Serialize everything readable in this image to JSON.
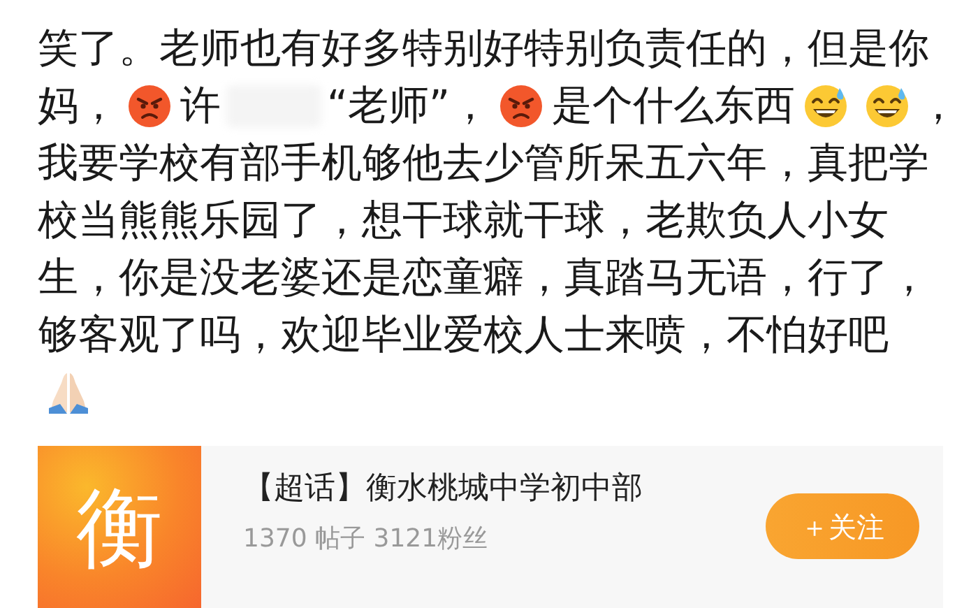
{
  "post": {
    "lines": [
      [
        {
          "kind": "text",
          "text": "笑了。老师也有好多特别好特别负责任的，但是你"
        }
      ],
      [
        {
          "kind": "text",
          "text": "妈，"
        },
        {
          "kind": "angry"
        },
        {
          "kind": "text",
          "text": "许"
        },
        {
          "kind": "blur"
        },
        {
          "kind": "text",
          "text": "“老师”，"
        },
        {
          "kind": "angry"
        },
        {
          "kind": "text",
          "text": "是个什么东西"
        },
        {
          "kind": "sweat"
        },
        {
          "kind": "sweat"
        },
        {
          "kind": "text",
          "text": "，"
        }
      ],
      [
        {
          "kind": "text",
          "text": "我要学校有部手机够他去少管所呆五六年，真把学"
        }
      ],
      [
        {
          "kind": "text",
          "text": "校当熊熊乐园了，想干球就干球，老欺负人小女"
        }
      ],
      [
        {
          "kind": "text",
          "text": "生，你是没老婆还是恋童癖，真踏马无语，行了，"
        }
      ],
      [
        {
          "kind": "text",
          "text": "够客观了吗，欢迎毕业爱校人士来喷，不怕好吧"
        }
      ],
      [
        {
          "kind": "pray"
        }
      ]
    ]
  },
  "topic_card": {
    "logo_char": "衡",
    "title": "【超话】衡水桃城中学初中部",
    "posts": "1370 帖子",
    "fans": "3121粉丝",
    "follow_button": "＋关注"
  }
}
